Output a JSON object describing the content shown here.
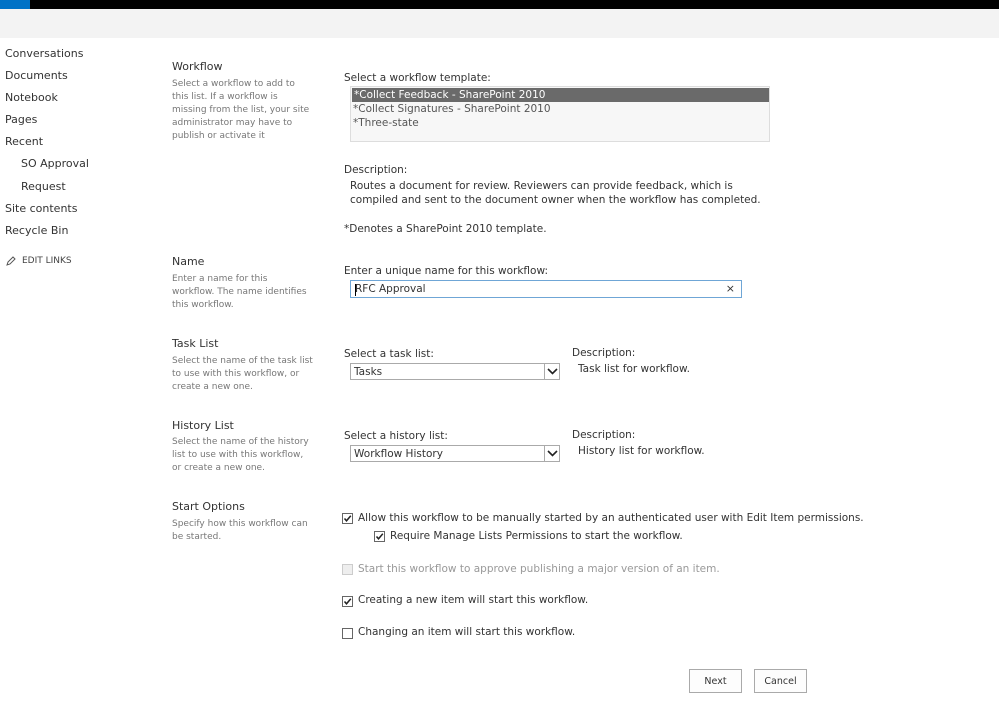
{
  "nav": {
    "items": [
      {
        "label": "Conversations"
      },
      {
        "label": "Documents"
      },
      {
        "label": "Notebook"
      },
      {
        "label": "Pages"
      },
      {
        "label": "Recent"
      },
      {
        "label": "SO Approval"
      },
      {
        "label": "Request"
      },
      {
        "label": "Site contents"
      },
      {
        "label": "Recycle Bin"
      }
    ],
    "edit_links": "EDIT LINKS"
  },
  "sections": {
    "workflow": {
      "title": "Workflow",
      "description": "Select a workflow to add to this list. If a workflow is missing from the list, your site administrator may have to publish or activate it"
    },
    "name": {
      "title": "Name",
      "description": "Enter a name for this workflow. The name identifies this workflow."
    },
    "task_list": {
      "title": "Task List",
      "description": "Select the name of the task list to use with this workflow, or create a new one."
    },
    "history_list": {
      "title": "History List",
      "description": "Select the name of the history list to use with this workflow, or create a new one."
    },
    "start_options": {
      "title": "Start Options",
      "description": "Specify how this workflow can be started."
    }
  },
  "template": {
    "label": "Select a workflow template:",
    "options": [
      "*Collect Feedback - SharePoint 2010",
      "*Collect Signatures - SharePoint 2010",
      "*Three-state"
    ],
    "selected_index": 0,
    "description_label": "Description:",
    "description": "Routes a document for review. Reviewers can provide feedback, which is compiled and sent to the document owner when the workflow has completed.",
    "note": "*Denotes a SharePoint 2010 template."
  },
  "name_field": {
    "label": "Enter a unique name for this workflow:",
    "value": "RFC Approval",
    "clear_glyph": "×"
  },
  "task_list": {
    "label": "Select a task list:",
    "value": "Tasks",
    "description_label": "Description:",
    "description": "Task list for workflow."
  },
  "history_list": {
    "label": "Select a history list:",
    "value": "Workflow History",
    "description_label": "Description:",
    "description": "History list for workflow."
  },
  "start_options": [
    {
      "label": "Allow this workflow to be manually started by an authenticated user with Edit Item permissions.",
      "checked": true,
      "disabled": false
    },
    {
      "label": "Require Manage Lists Permissions to start the workflow.",
      "checked": true,
      "disabled": false
    },
    {
      "label": "Start this workflow to approve publishing a major version of an item.",
      "checked": false,
      "disabled": true
    },
    {
      "label": "Creating a new item will start this workflow.",
      "checked": true,
      "disabled": false
    },
    {
      "label": "Changing an item will start this workflow.",
      "checked": false,
      "disabled": false
    }
  ],
  "buttons": {
    "next": "Next",
    "cancel": "Cancel"
  },
  "colors": {
    "accent": "#0072c6",
    "selected_option_bg": "#6a6a6a"
  }
}
